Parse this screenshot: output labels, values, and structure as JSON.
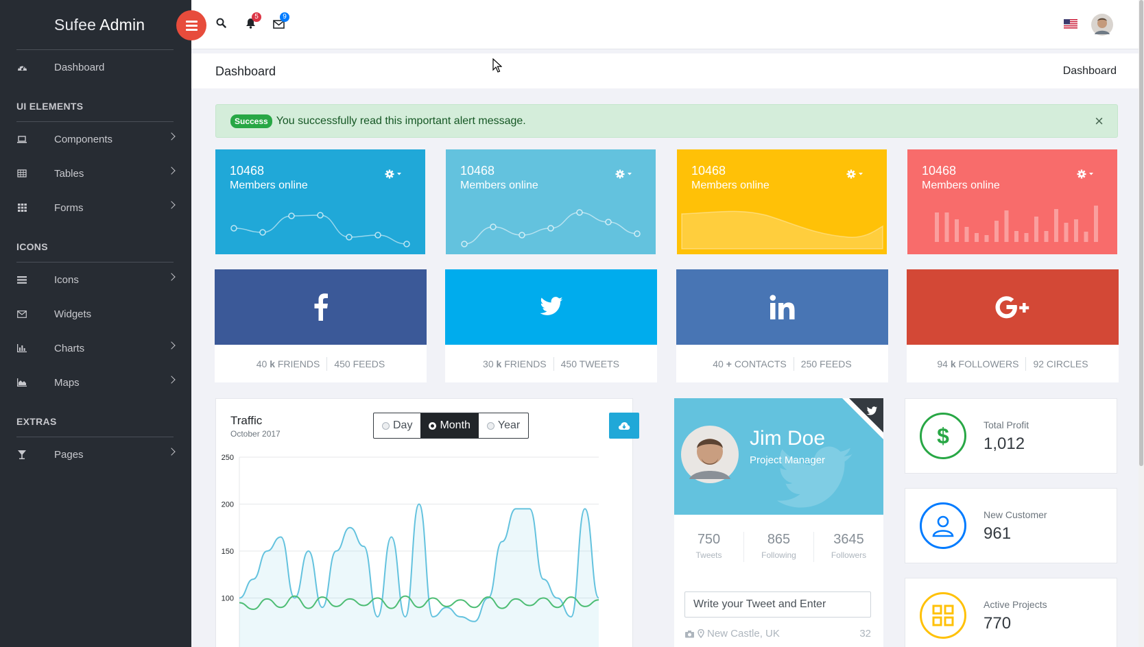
{
  "brand": {
    "light": "Sufee",
    "bold": "Admin"
  },
  "sidebar": {
    "dashboard": "Dashboard",
    "sections": [
      {
        "title": "UI ELEMENTS",
        "items": [
          {
            "label": "Components",
            "icon": "laptop-icon",
            "chevron": true
          },
          {
            "label": "Tables",
            "icon": "table-icon",
            "chevron": true
          },
          {
            "label": "Forms",
            "icon": "grid-icon",
            "chevron": true
          }
        ]
      },
      {
        "title": "ICONS",
        "items": [
          {
            "label": "Icons",
            "icon": "list-icon",
            "chevron": true
          },
          {
            "label": "Widgets",
            "icon": "envelope-icon",
            "chevron": false
          },
          {
            "label": "Charts",
            "icon": "bar-chart-icon",
            "chevron": true
          },
          {
            "label": "Maps",
            "icon": "area-chart-icon",
            "chevron": true
          }
        ]
      },
      {
        "title": "EXTRAS",
        "items": [
          {
            "label": "Pages",
            "icon": "glass-icon",
            "chevron": true
          }
        ]
      }
    ]
  },
  "header": {
    "notifications": "5",
    "messages": "9"
  },
  "breadcrumbs": {
    "title": "Dashboard",
    "current": "Dashboard"
  },
  "alert": {
    "badge": "Success",
    "message": "You successfully read this important alert message.",
    "close": "×"
  },
  "stats": [
    {
      "value": "10468",
      "label": "Members online",
      "color": "#20a8d8"
    },
    {
      "value": "10468",
      "label": "Members online",
      "color": "#63c2de"
    },
    {
      "value": "10468",
      "label": "Members online",
      "color": "#ffc107"
    },
    {
      "value": "10468",
      "label": "Members online",
      "color": "#f86c6b"
    }
  ],
  "social": [
    {
      "network": "facebook",
      "color": "#3b5998",
      "a_num": "40",
      "a_unit": "k",
      "a_label": "FRIENDS",
      "b": "450 FEEDS"
    },
    {
      "network": "twitter",
      "color": "#00aced",
      "a_num": "30",
      "a_unit": "k",
      "a_label": "FRIENDS",
      "b": "450 TWEETS"
    },
    {
      "network": "linkedin",
      "color": "#4875b4",
      "a_num": "40",
      "a_unit": "+",
      "a_label": "CONTACTS",
      "b": "250 FEEDS"
    },
    {
      "network": "google-plus",
      "color": "#d34836",
      "a_num": "94",
      "a_unit": "k",
      "a_label": "FOLLOWERS",
      "b": "92 CIRCLES"
    }
  ],
  "traffic": {
    "title": "Traffic",
    "subtitle": "October 2017",
    "options": [
      "Day",
      "Month",
      "Year"
    ],
    "selected": "Month"
  },
  "chart_data": {
    "type": "area",
    "title": "Traffic",
    "yticks": [
      100,
      150,
      200,
      250
    ],
    "ylim": [
      80,
      255
    ],
    "grid": true,
    "series": [
      {
        "values": [
          100,
          120,
          150,
          165,
          100,
          150,
          90,
          150,
          175,
          155,
          80,
          165,
          80,
          200,
          80,
          90,
          80,
          75,
          100,
          160,
          195,
          195,
          120,
          100,
          80,
          195,
          100
        ]
      },
      {
        "values": [
          95,
          88,
          99,
          90,
          102,
          89,
          101,
          91,
          99,
          92,
          100,
          89,
          102,
          90,
          100,
          91,
          98,
          90,
          101,
          89,
          99,
          92,
          100,
          90,
          101,
          91,
          98
        ]
      }
    ]
  },
  "profile": {
    "name": "Jim Doe",
    "role": "Project Manager",
    "stats": [
      {
        "value": "750",
        "label": "Tweets"
      },
      {
        "value": "865",
        "label": "Following"
      },
      {
        "value": "3645",
        "label": "Followers"
      }
    ],
    "tweet_placeholder": "Write your Tweet and Enter",
    "location": "New Castle, UK",
    "count": "32"
  },
  "minis": [
    {
      "label": "Total Profit",
      "value": "1,012",
      "color": "#28a745",
      "icon": "dollar-icon"
    },
    {
      "label": "New Customer",
      "value": "961",
      "color": "#007bff",
      "icon": "user-icon"
    },
    {
      "label": "Active Projects",
      "value": "770",
      "color": "#ffc107",
      "icon": "layout-icon"
    }
  ]
}
